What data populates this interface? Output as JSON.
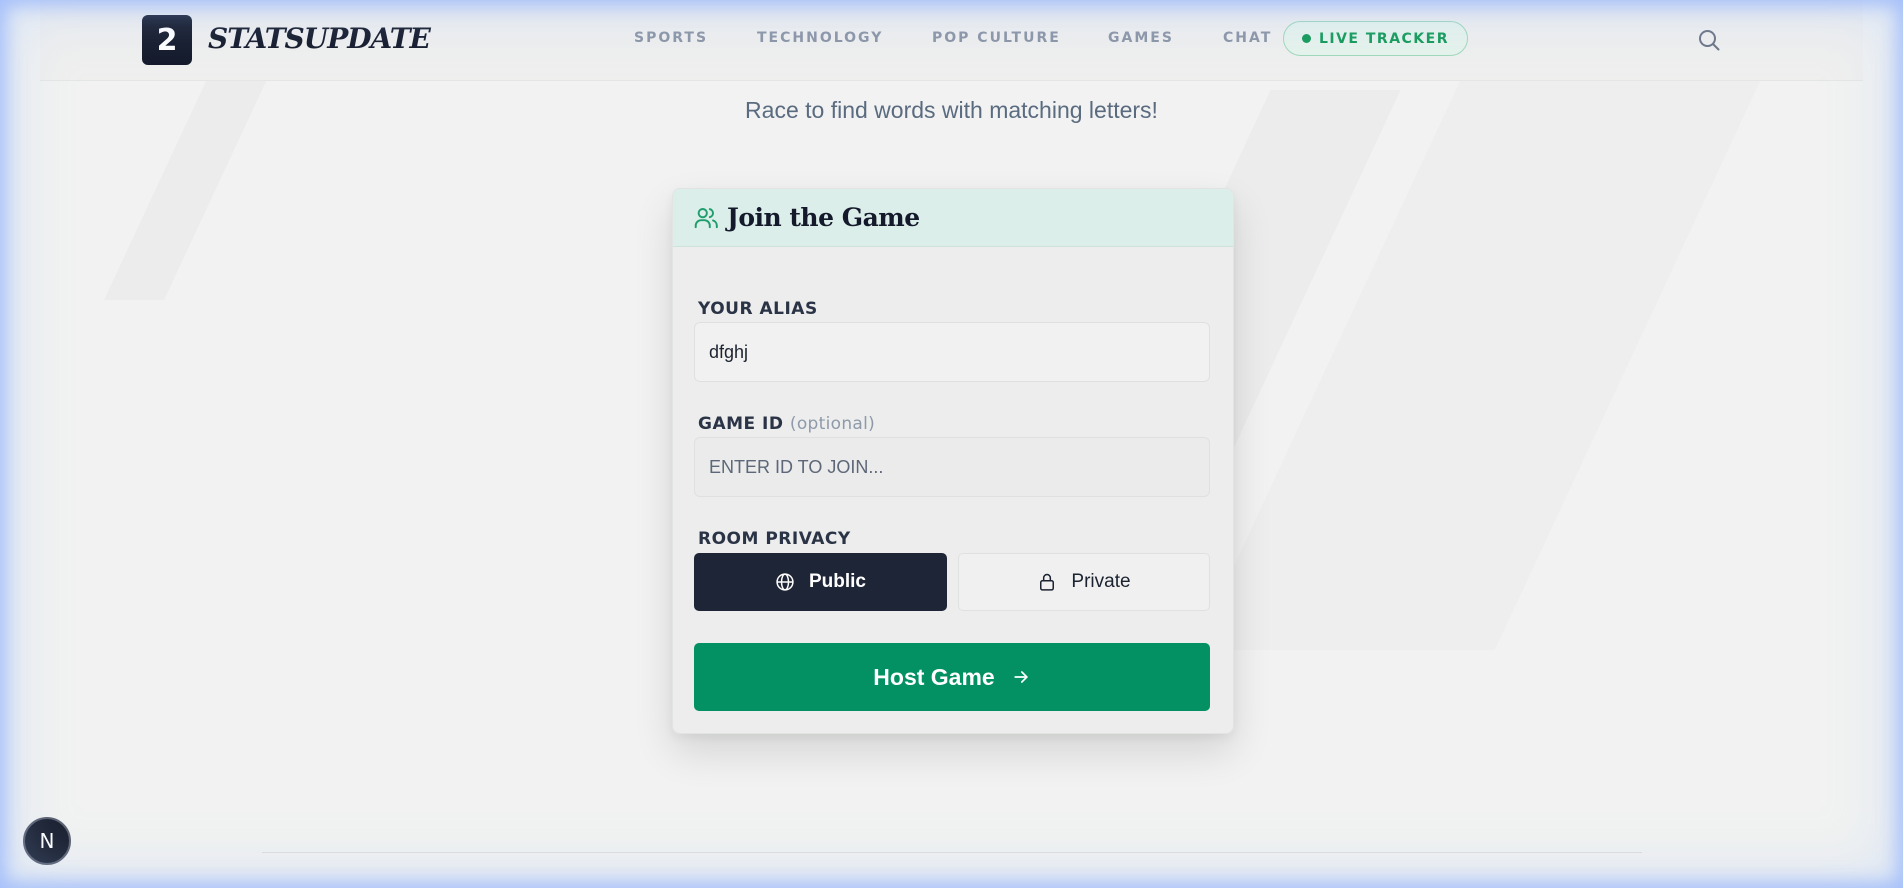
{
  "header": {
    "logo_mark": "2",
    "logo_text": "STATSUPDATE",
    "nav": [
      "SPORTS",
      "TECHNOLOGY",
      "POP CULTURE",
      "GAMES",
      "CHAT"
    ],
    "live_label": "LIVE TRACKER",
    "search_icon": "search-icon"
  },
  "subtitle": "Race to find words with matching letters!",
  "card": {
    "title": "Join the Game",
    "title_icon": "users-icon",
    "alias_label": "YOUR ALIAS",
    "alias_value": "dfghj",
    "game_id_label": "GAME ID",
    "game_id_optional": "(optional)",
    "game_id_placeholder": "ENTER ID TO JOIN...",
    "privacy_label": "ROOM PRIVACY",
    "privacy_options": [
      {
        "label": "Public",
        "icon": "globe-icon",
        "selected": true
      },
      {
        "label": "Private",
        "icon": "lock-icon",
        "selected": false
      }
    ],
    "host_button": "Host Game"
  },
  "dev_badge": "N",
  "colors": {
    "brand_dark": "#141a2b",
    "accent_green": "#039163",
    "live_green": "#149a58"
  }
}
